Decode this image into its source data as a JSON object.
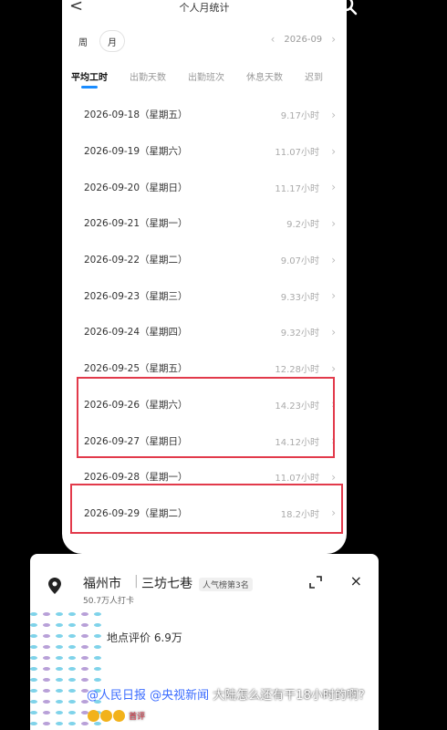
{
  "header": {
    "title": "个人月统计",
    "back_glyph": "<"
  },
  "period": {
    "week": "周",
    "month": "月",
    "current": "2026-09",
    "prev_glyph": "‹",
    "next_glyph": "›"
  },
  "tabs": [
    "平均工时",
    "出勤天数",
    "出勤班次",
    "休息天数",
    "迟到"
  ],
  "rows": [
    {
      "date": "2026-09-18（星期五）",
      "hours": "9.17小时"
    },
    {
      "date": "2026-09-19（星期六）",
      "hours": "11.07小时"
    },
    {
      "date": "2026-09-20（星期日）",
      "hours": "11.17小时"
    },
    {
      "date": "2026-09-21（星期一）",
      "hours": "9.2小时"
    },
    {
      "date": "2026-09-22（星期二）",
      "hours": "9.07小时"
    },
    {
      "date": "2026-09-23（星期三）",
      "hours": "9.33小时"
    },
    {
      "date": "2026-09-24（星期四）",
      "hours": "9.32小时"
    },
    {
      "date": "2026-09-25（星期五）",
      "hours": "12.28小时"
    },
    {
      "date": "2026-09-26（星期六）",
      "hours": "14.23小时"
    },
    {
      "date": "2026-09-27（星期日）",
      "hours": "14.12小时"
    },
    {
      "date": "2026-09-28（星期一）",
      "hours": "11.07小时"
    },
    {
      "date": "2026-09-29（星期二）",
      "hours": "18.2小时"
    }
  ],
  "row_arrow": "›",
  "location": {
    "city": "福州市",
    "separator": "|",
    "spot": "三坊七巷",
    "rank": "人气榜第3名",
    "checkins": "50.7万人打卡",
    "rating": "地点评价 6.9万",
    "close_glyph": "×"
  },
  "comment": {
    "mention1": "@人民日报",
    "mention2": "@央视新闻",
    "text": " 大陆怎么还有干18小时的啊?",
    "badge": "首评"
  },
  "colors": {
    "highlight": "#e23a4b",
    "accent": "#1a8cff",
    "mention": "#3b6cff"
  }
}
